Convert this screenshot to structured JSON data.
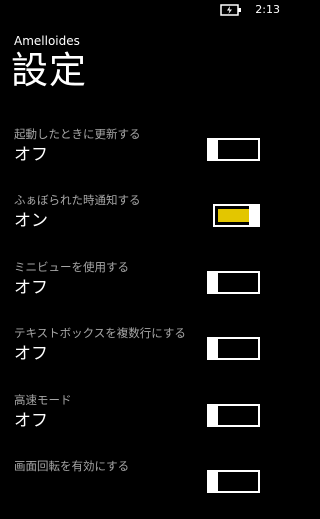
{
  "status_bar": {
    "time": "2:13",
    "battery_icon": "battery-charging-icon"
  },
  "app": {
    "name": "Amelloides",
    "title": "設定"
  },
  "settings": [
    {
      "label": "起動したときに更新する",
      "value": "オフ",
      "on": false
    },
    {
      "label": "ふぁぼられた時通知する",
      "value": "オン",
      "on": true
    },
    {
      "label": "ミニビューを使用する",
      "value": "オフ",
      "on": false
    },
    {
      "label": "テキストボックスを複数行にする",
      "value": "オフ",
      "on": false
    },
    {
      "label": "高速モード",
      "value": "オフ",
      "on": false
    },
    {
      "label": "画面回転を有効にする",
      "value": "",
      "on": false
    }
  ],
  "colors": {
    "background": "#000000",
    "accent": "#e3c600",
    "label": "#a6a6a6",
    "text": "#ffffff"
  }
}
